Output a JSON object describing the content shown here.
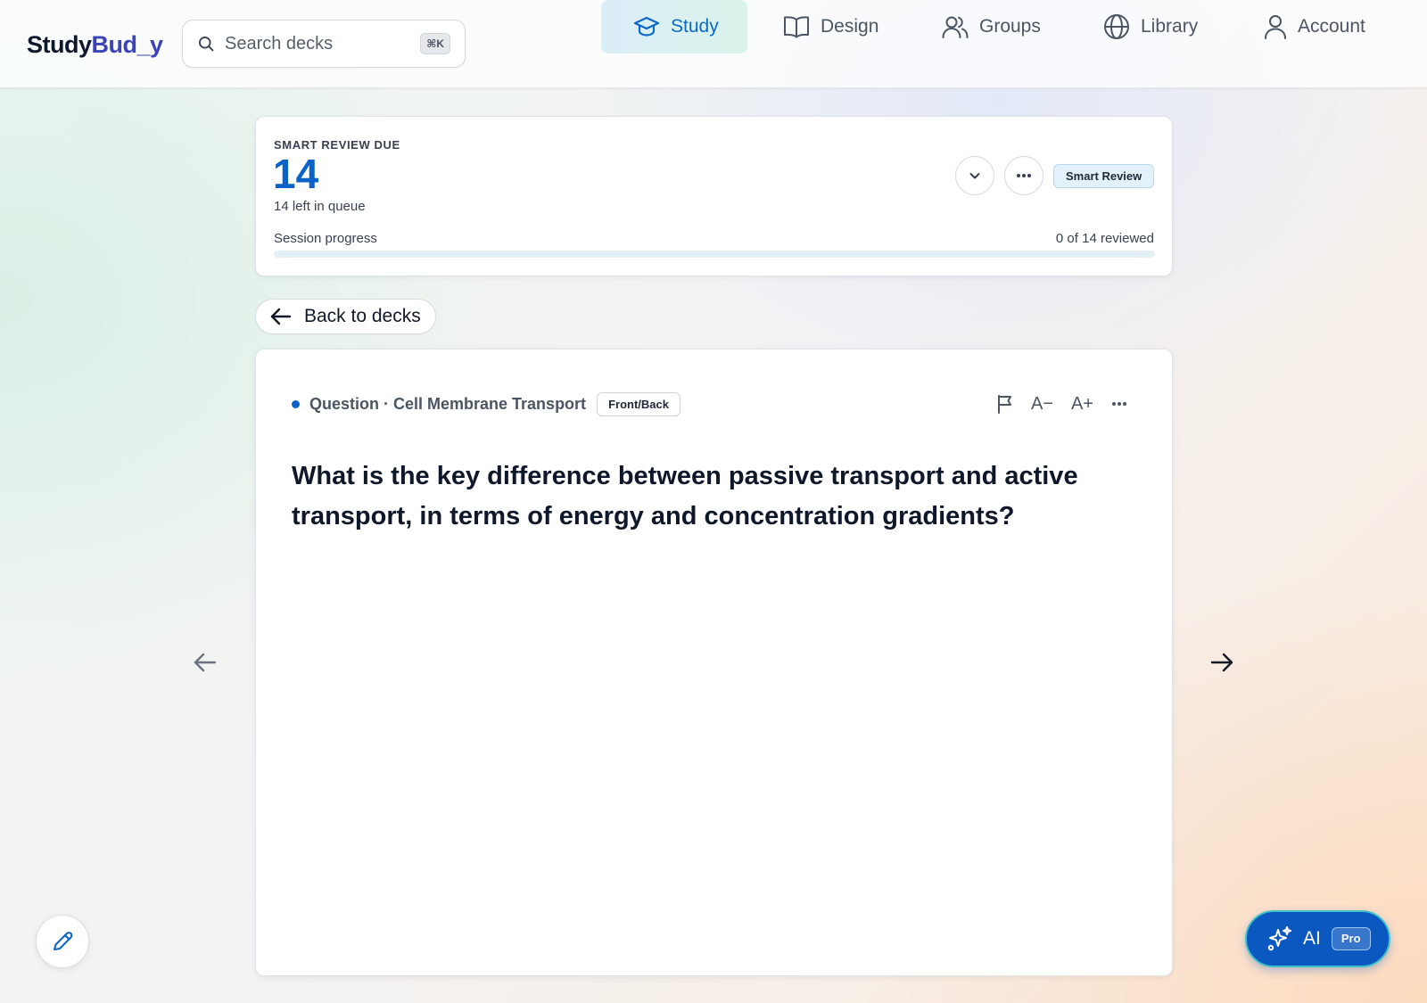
{
  "app": {
    "logo_primary": "Study",
    "logo_accent": "Bud_y"
  },
  "search": {
    "placeholder": "Search decks",
    "value": "",
    "shortcut": "⌘K"
  },
  "nav": {
    "items": [
      {
        "label": "Study",
        "icon": "graduation-cap-icon",
        "active": true
      },
      {
        "label": "Design",
        "icon": "open-book-icon",
        "active": false
      },
      {
        "label": "Groups",
        "icon": "users-icon",
        "active": false
      },
      {
        "label": "Library",
        "icon": "globe-icon",
        "active": false
      },
      {
        "label": "Account",
        "icon": "user-icon",
        "active": false
      }
    ]
  },
  "review": {
    "eyebrow": "SMART REVIEW DUE",
    "count": "14",
    "queue_text": "14 left in queue",
    "mode_badge": "Smart Review",
    "progress_label": "Session progress",
    "progress_text": "0 of 14 reviewed",
    "progress_fraction": 0
  },
  "back": {
    "label": "Back to decks"
  },
  "card": {
    "meta": "Question · Cell Membrane Transport",
    "type_badge": "Front/Back",
    "tools": {
      "decrease_font": "A−",
      "increase_font": "A+"
    },
    "question": "What is the key difference between passive transport and active transport, in terms of energy and concentration gradients?"
  },
  "fab": {
    "ai_label": "AI",
    "pro_badge": "Pro"
  },
  "colors": {
    "accent": "#0b62c9",
    "logo_accent": "#3b43b8",
    "ai_button": "#0b58c0",
    "ai_button_border": "#3fc1c9"
  }
}
